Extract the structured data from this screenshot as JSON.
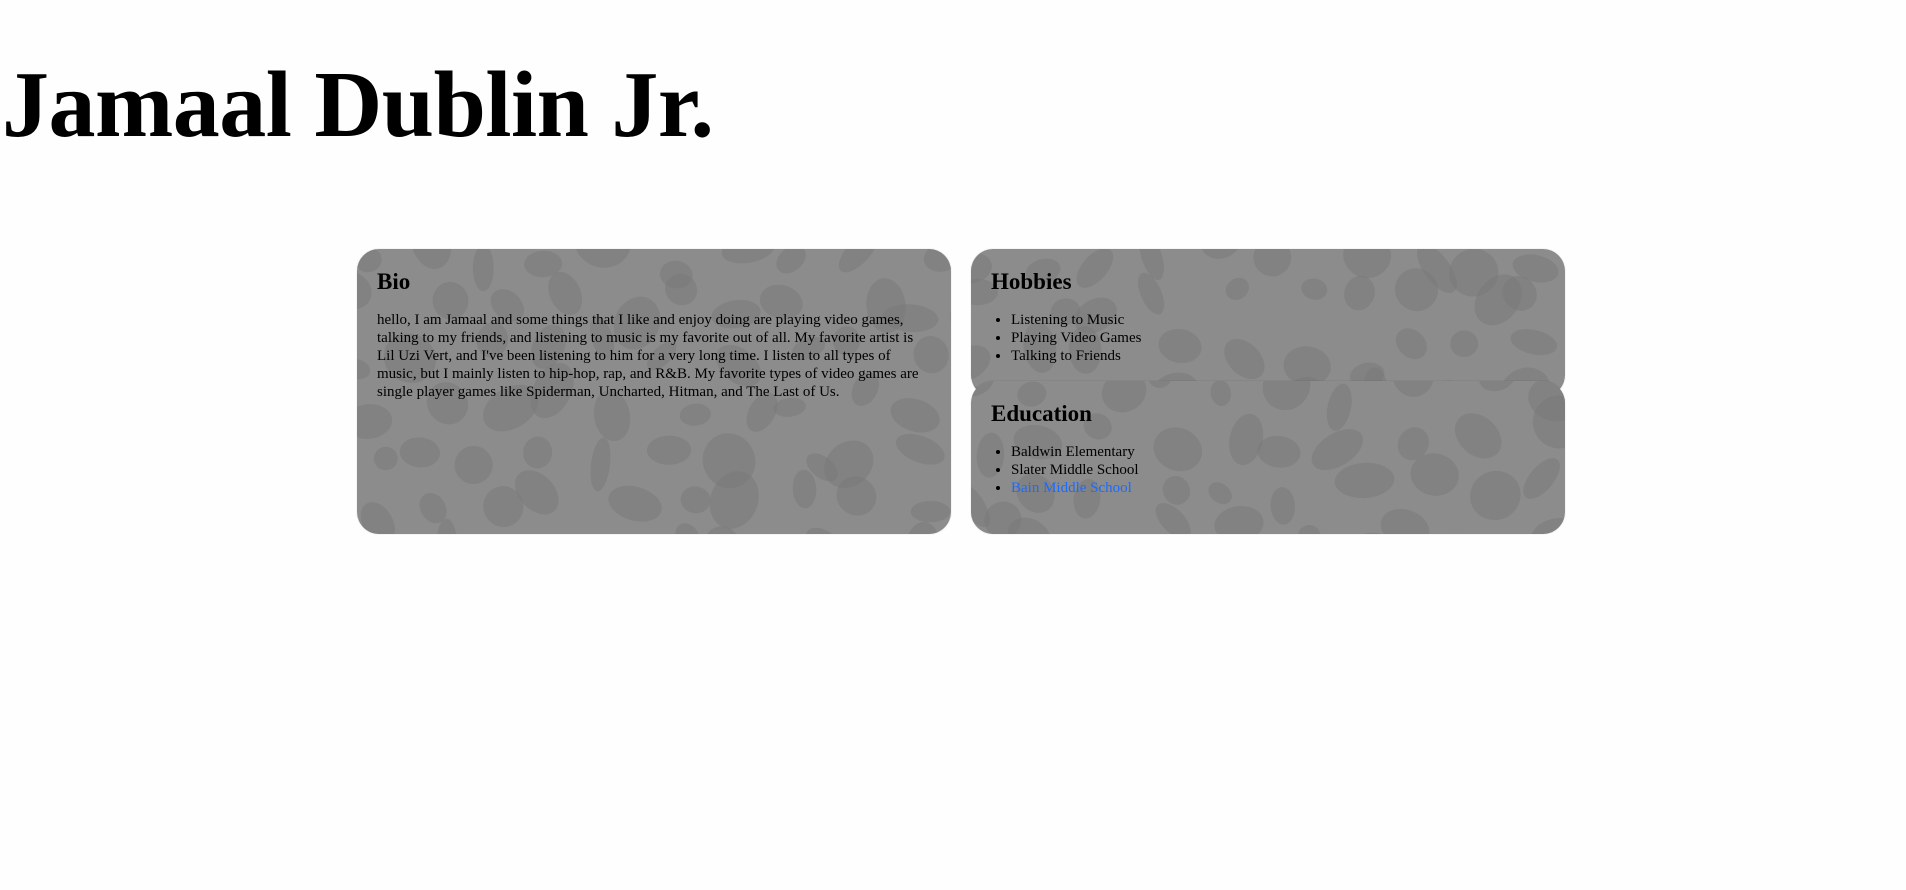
{
  "page": {
    "title": "Jamaal Dublin Jr."
  },
  "colors": {
    "card_background": "#8c8c8c",
    "card_spots": "#7a7a7a",
    "link": "#1a6bff",
    "page_background": "#fefefe"
  },
  "bio": {
    "heading": "Bio",
    "text": "hello, I am Jamaal and some things that I like and enjoy doing are playing video games, talking to my friends, and listening to music is my favorite out of all. My favorite artist is Lil Uzi Vert, and I've been listening to him for a very long time. I listen to all types of music, but I mainly listen to hip-hop, rap, and R&B. My favorite types of video games are single player games like Spiderman, Uncharted, Hitman, and The Last of Us."
  },
  "hobbies": {
    "heading": "Hobbies",
    "items": [
      "Listening to Music",
      "Playing Video Games",
      "Talking to Friends"
    ]
  },
  "education": {
    "heading": "Education",
    "items": [
      "Baldwin Elementary",
      "Slater Middle School"
    ],
    "link_item": "Bain Middle School"
  }
}
